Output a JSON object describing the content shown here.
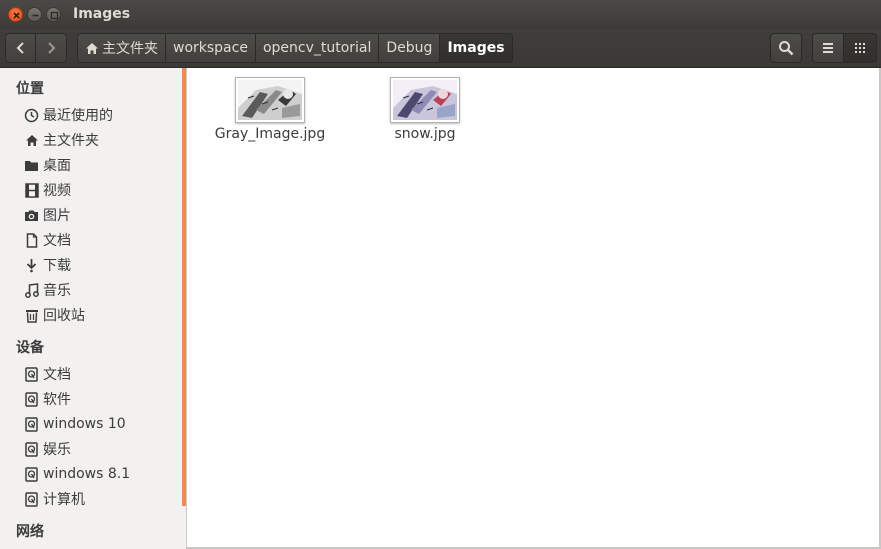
{
  "window": {
    "title": "Images"
  },
  "toolbar": {
    "breadcrumbs": [
      {
        "label": "主文件夹",
        "icon": "home-icon"
      },
      {
        "label": "workspace"
      },
      {
        "label": "opencv_tutorial"
      },
      {
        "label": "Debug"
      },
      {
        "label": "Images",
        "active": true
      }
    ]
  },
  "sidebar": {
    "places_header": "位置",
    "places": [
      {
        "label": "最近使用的",
        "icon": "clock-icon"
      },
      {
        "label": "主文件夹",
        "icon": "home-icon"
      },
      {
        "label": "桌面",
        "icon": "folder-icon"
      },
      {
        "label": "视频",
        "icon": "film-icon"
      },
      {
        "label": "图片",
        "icon": "camera-icon"
      },
      {
        "label": "文档",
        "icon": "document-icon"
      },
      {
        "label": "下载",
        "icon": "download-icon"
      },
      {
        "label": "音乐",
        "icon": "music-icon"
      },
      {
        "label": "回收站",
        "icon": "trash-icon"
      }
    ],
    "devices_header": "设备",
    "devices": [
      {
        "label": "文档",
        "icon": "drive-icon"
      },
      {
        "label": "软件",
        "icon": "drive-icon"
      },
      {
        "label": "windows 10",
        "icon": "drive-icon"
      },
      {
        "label": "娱乐",
        "icon": "drive-icon"
      },
      {
        "label": "windows 8.1",
        "icon": "drive-icon"
      },
      {
        "label": "计算机",
        "icon": "drive-icon"
      }
    ],
    "network_header": "网络"
  },
  "files": [
    {
      "name": "Gray_Image.jpg",
      "thumbnail": "grayscale-image-thumbnail"
    },
    {
      "name": "snow.jpg",
      "thumbnail": "color-image-thumbnail"
    }
  ],
  "colors": {
    "accent": "#ef8a55",
    "close_button": "#df4a16",
    "titlebar": "#3c3b37"
  }
}
